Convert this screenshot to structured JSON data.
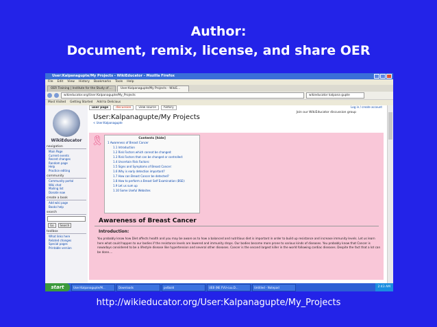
{
  "slide": {
    "title_line1": "Author:",
    "title_line2": "Document, remix, license, and share OER",
    "url": "http://wikieducator.org/User:Kalpanagupte/My_Projects"
  },
  "browser": {
    "window_title": "User:Kalpanagupte/My Projects - WikiEducator - Mozilla Firefox",
    "menu": [
      "File",
      "Edit",
      "View",
      "History",
      "Bookmarks",
      "Tools",
      "Help"
    ],
    "tabs": [
      "OER Training | Institute for the Study of ...",
      "User:Kalpanagupte/My Projects - WikiE..."
    ],
    "address": "wikieducator.org/User:Kalpanagupte/My_Projects",
    "search_value": "wikieducator kalpana gupte",
    "bookmarks": [
      "Most Visited",
      "Getting Started",
      "Add to Delicious"
    ]
  },
  "sidebar": {
    "logo_text": "WikiEducator",
    "navigation_head": "navigation",
    "navigation": [
      "Main Page",
      "Current events",
      "Recent changes",
      "Random page",
      "Help",
      "Practice editing"
    ],
    "community_head": "community",
    "community": [
      "Community portal",
      "Wiki chat",
      "Mailing list",
      "Donate now"
    ],
    "create_head": "create a book",
    "create": [
      "Add wiki page",
      "Books help"
    ],
    "search_head": "search",
    "go_label": "Go",
    "search_label": "Search",
    "toolbox_head": "toolbox",
    "toolbox": [
      "What links here",
      "Related changes",
      "Special pages",
      "Printable version"
    ]
  },
  "content": {
    "tabs": [
      "user page",
      "discussion",
      "view source",
      "history"
    ],
    "login": "Log in / create account",
    "notice": "Join our WikiEducator discussion group",
    "page_title": "User:Kalpanagupte/My Projects",
    "breadcrumb": "< User:Kalpanagupte",
    "toc_head": "Contents [hide]",
    "toc": [
      "1 Awareness of Breast Cancer",
      "1.1 Introduction",
      "1.2 Risk Factors which cannot be changed:",
      "1.3 Risk Factors that can be changed or controlled:",
      "1.4 Uncertain Risk Factors:",
      "1.5 Signs and Symptoms of Breast Cancer:",
      "1.6 Why is early detection important?",
      "1.7 How can Breast Cancer be detected?",
      "1.8 How to perform a Breast Self Examination (BSE):",
      "1.9 Let us sum up",
      "1.10 Some Useful Websites"
    ],
    "heading": "Awareness of Breast Cancer",
    "subheading": "Introduction:",
    "paragraph": "You probably know how Diet affects health and you may be aware as to how a balanced and nutritious diet is important in order to build up resistance and increase immunity levels. Let us learn here what could happen to our bodies if the resistance levels are lowered and immunity drops. Our bodies become more prone to various kinds of diseases. You probably know that Cancer is nowadays considered to be a lifestyle disease like hypertension and several other diseases. Cancer is the second largest killer in the world following cardiac diseases. Despite the fact that a lot can be done...."
  },
  "taskbar": {
    "start": "start",
    "items": [
      "User:Kalpanagupte/M...",
      "Downloads",
      "pxtbold",
      "UEB (NE FVU-cuu.D...",
      "Untitled - Notepad"
    ],
    "clock": "2:43 AM"
  }
}
